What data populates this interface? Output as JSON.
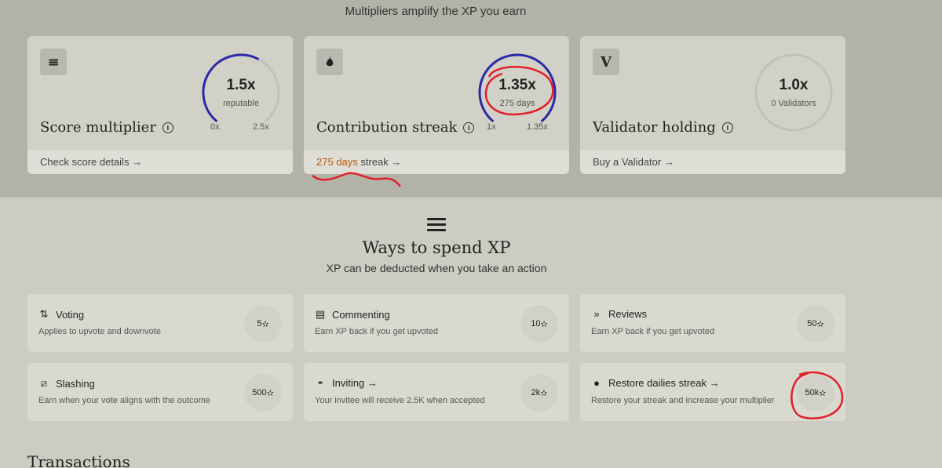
{
  "header": {
    "subtitle": "Multipliers amplify the XP you earn"
  },
  "multipliers": [
    {
      "icon": "sliders-icon",
      "icon_glyph": "≡",
      "title": "Score multiplier",
      "value": "1.5x",
      "sub": "reputable",
      "min": "0x",
      "max": "2.5x",
      "progress": 0.6,
      "footer": "Check score details",
      "footer_accent": ""
    },
    {
      "icon": "flame-icon",
      "icon_glyph": "🔥",
      "title": "Contribution streak",
      "value": "1.35x",
      "sub": "275 days",
      "min": "1x",
      "max": "1.35x",
      "progress": 1.0,
      "footer": " streak",
      "footer_accent": "275 days"
    },
    {
      "icon": "validator-v-icon",
      "icon_glyph": "V",
      "title": "Validator holding",
      "value": "1.0x",
      "sub": "0 Validators",
      "min": "",
      "max": "",
      "progress": 0,
      "footer": "Buy a Validator",
      "footer_accent": ""
    }
  ],
  "spend": {
    "title": "Ways to spend XP",
    "subtitle": "XP can be deducted when you take an action"
  },
  "actions": [
    {
      "icon": "arrows-updown-icon",
      "glyph": "⇅",
      "name": "Voting",
      "desc": "Applies to upvote and downvote",
      "cost": "5"
    },
    {
      "icon": "comment-icon",
      "glyph": "▤",
      "name": "Commenting",
      "desc": "Earn XP back if you get upvoted",
      "cost": "10"
    },
    {
      "icon": "review-icon",
      "glyph": "»",
      "name": "Reviews",
      "desc": "Earn XP back if you get upvoted",
      "cost": "50"
    },
    {
      "icon": "slash-icon",
      "glyph": "⧄",
      "name": "Slashing",
      "desc": "Earn when your vote aligns with the outcome",
      "cost": "500"
    },
    {
      "icon": "user-invite-icon",
      "glyph": "◓",
      "name": "Inviting →",
      "desc": "Your invitee will receive 2.5K when accepted",
      "cost": "2k"
    },
    {
      "icon": "drop-icon",
      "glyph": "●",
      "name": "Restore dailies streak →",
      "desc": "Restore your streak and increase your multiplier",
      "cost": "50k"
    }
  ],
  "xp_star": "✫",
  "transactions": {
    "title": "Transactions"
  },
  "colors": {
    "gauge_active": "#2a2aa8",
    "gauge_track": "#c2c1b8",
    "accent": "#b35a12",
    "annotation": "#e0202a"
  }
}
